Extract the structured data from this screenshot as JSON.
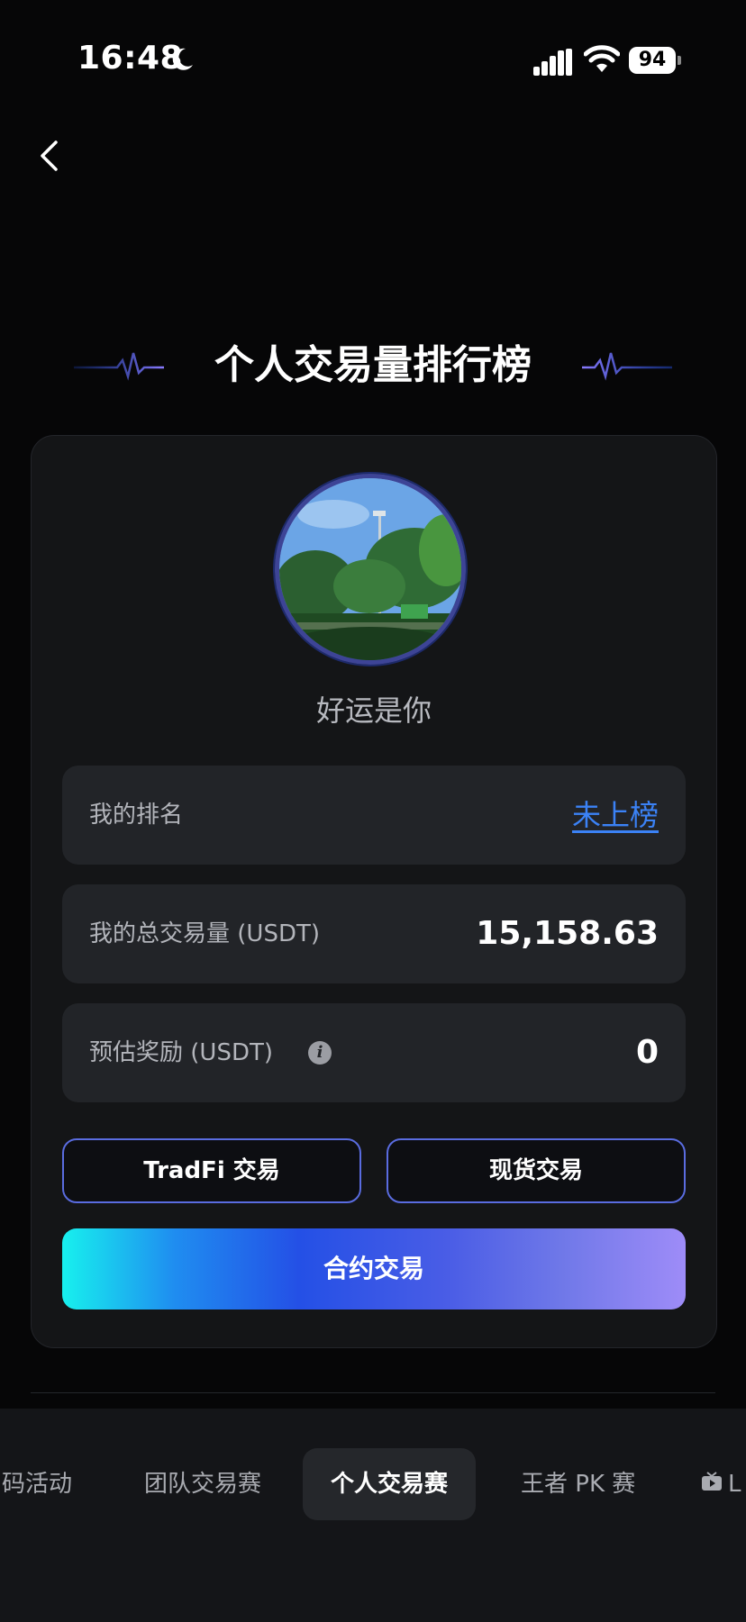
{
  "status_bar": {
    "time": "16:48",
    "battery": "94"
  },
  "page": {
    "title": "个人交易量排行榜"
  },
  "profile": {
    "username": "好运是你"
  },
  "stats": {
    "rank_label": "我的排名",
    "rank_value": "未上榜",
    "volume_label": "我的总交易量 (USDT)",
    "volume_value": "15,158.63",
    "reward_label": "预估奖励 (USDT)",
    "reward_value": "0"
  },
  "actions": {
    "tradfi_label": "TradFi 交易",
    "spot_label": "现货交易",
    "futures_label": "合约交易"
  },
  "tabs": {
    "items": [
      "码活动",
      "团队交易赛",
      "个人交易赛",
      "王者 PK 赛",
      "L"
    ],
    "active": "个人交易赛"
  },
  "colors": {
    "accent_blue": "#3b82f6",
    "outline_border": "#5a6ce0",
    "gradient_start": "#17f0ee",
    "gradient_end": "#9e8cf8"
  },
  "icons": [
    "moon-icon",
    "signal-icon",
    "wifi-icon",
    "battery-icon",
    "back-chevron-icon",
    "info-icon",
    "live-tv-icon"
  ]
}
